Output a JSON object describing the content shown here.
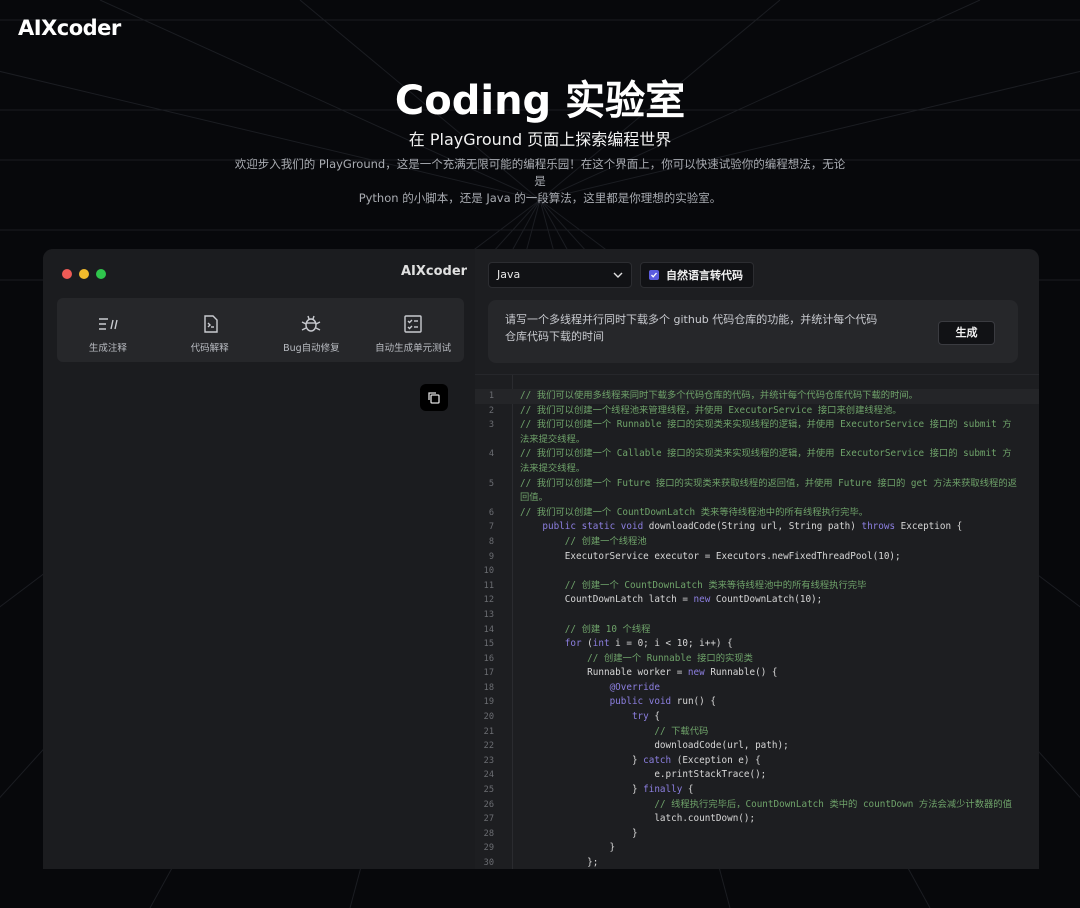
{
  "brand": {
    "logo": "AIXcoder",
    "panel_logo": "AIXcoder"
  },
  "hero": {
    "title": "Coding 实验室",
    "subtitle": "在 PlayGround 页面上探索编程世界",
    "description_line1": "欢迎步入我们的 PlayGround，这是一个充满无限可能的编程乐园！在这个界面上，你可以快速试验你的编程想法，无论是",
    "description_line2": "Python 的小脚本，还是 Java 的一段算法，这里都是你理想的实验室。"
  },
  "tools": [
    {
      "label": "生成注释",
      "icon": "comment-gen-icon"
    },
    {
      "label": "代码解释",
      "icon": "code-explain-icon"
    },
    {
      "label": "Bug自动修复",
      "icon": "bug-fix-icon"
    },
    {
      "label": "自动生成单元测试",
      "icon": "unit-test-icon"
    }
  ],
  "controls": {
    "language": "Java",
    "nl_to_code_label": "自然语言转代码",
    "nl_to_code_checked": true,
    "prompt_line1": "请写一个多线程并行同时下载多个 github 代码仓库的功能，并统计每个代码",
    "prompt_line2": "仓库代码下载的时间",
    "generate_label": "生成"
  },
  "colors": {
    "accent": "#5b5ce0",
    "comment": "#6fa36a",
    "keyword": "#8c7fe0",
    "background": "#07080b",
    "panel": "#1d1e21"
  },
  "code": [
    {
      "n": "1",
      "text": "// 我们可以使用多线程来同时下载多个代码仓库的代码，并统计每个代码仓库代码下载的时间。"
    },
    {
      "n": "2",
      "text": "// 我们可以创建一个线程池来管理线程，并使用 ExecutorService 接口来创建线程池。"
    },
    {
      "n": "3",
      "text": "// 我们可以创建一个 Runnable 接口的实现类来实现线程的逻辑，并使用 ExecutorService 接口的 submit 方"
    },
    {
      "n": "",
      "text": "法来提交线程。"
    },
    {
      "n": "4",
      "text": "// 我们可以创建一个 Callable 接口的实现类来实现线程的逻辑，并使用 ExecutorService 接口的 submit 方"
    },
    {
      "n": "",
      "text": "法来提交线程。"
    },
    {
      "n": "5",
      "text": "// 我们可以创建一个 Future 接口的实现类来获取线程的返回值，并使用 Future 接口的 get 方法来获取线程的返"
    },
    {
      "n": "",
      "text": "回值。"
    },
    {
      "n": "6",
      "text": "// 我们可以创建一个 CountDownLatch 类来等待线程池中的所有线程执行完毕。"
    },
    {
      "n": "7",
      "text": "    public static void downloadCode(String url, String path) throws Exception {"
    },
    {
      "n": "8",
      "text": "        // 创建一个线程池"
    },
    {
      "n": "9",
      "text": "        ExecutorService executor = Executors.newFixedThreadPool(10);"
    },
    {
      "n": "10",
      "text": ""
    },
    {
      "n": "11",
      "text": "        // 创建一个 CountDownLatch 类来等待线程池中的所有线程执行完毕"
    },
    {
      "n": "12",
      "text": "        CountDownLatch latch = new CountDownLatch(10);"
    },
    {
      "n": "13",
      "text": ""
    },
    {
      "n": "14",
      "text": "        // 创建 10 个线程"
    },
    {
      "n": "15",
      "text": "        for (int i = 0; i < 10; i++) {"
    },
    {
      "n": "16",
      "text": "            // 创建一个 Runnable 接口的实现类"
    },
    {
      "n": "17",
      "text": "            Runnable worker = new Runnable() {"
    },
    {
      "n": "18",
      "text": "                @Override"
    },
    {
      "n": "19",
      "text": "                public void run() {"
    },
    {
      "n": "20",
      "text": "                    try {"
    },
    {
      "n": "21",
      "text": "                        // 下载代码"
    },
    {
      "n": "22",
      "text": "                        downloadCode(url, path);"
    },
    {
      "n": "23",
      "text": "                    } catch (Exception e) {"
    },
    {
      "n": "24",
      "text": "                        e.printStackTrace();"
    },
    {
      "n": "25",
      "text": "                    } finally {"
    },
    {
      "n": "26",
      "text": "                        // 线程执行完毕后，CountDownLatch 类中的 countDown 方法会减少计数器的值"
    },
    {
      "n": "27",
      "text": "                        latch.countDown();"
    },
    {
      "n": "28",
      "text": "                    }"
    },
    {
      "n": "29",
      "text": "                }"
    },
    {
      "n": "30",
      "text": "            };"
    }
  ]
}
